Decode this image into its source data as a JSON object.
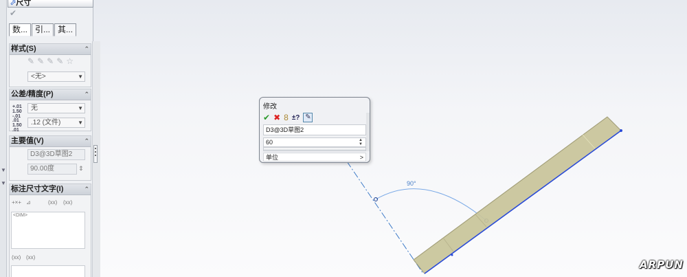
{
  "property_manager": {
    "title": "尺寸",
    "tabs": [
      "数...",
      "引...",
      "其..."
    ],
    "style_group": {
      "header": "样式(S)",
      "style_dropdown": "<无>"
    },
    "tolerance_group": {
      "header": "公差/精度(P)",
      "tolerance_type": "无",
      "precision": ".12 (文件)"
    },
    "primary_value_group": {
      "header": "主要值(V)",
      "dimension_name": "D3@3D草图2",
      "value": "90.00度"
    },
    "dimension_text_group": {
      "header": "标注尺寸文字(I)",
      "text_box_1": "<DIM>",
      "paren_1": "(xx)",
      "paren_2": "(xx)",
      "paren_3": "(xx)",
      "paren_4": "(xx)"
    }
  },
  "modify_dialog": {
    "title": "修改",
    "toolbar": [
      "✔",
      "✖",
      "8",
      "±?",
      "✎"
    ],
    "dimension_name": "D3@3D草图2",
    "value": "60",
    "units_label": "单位",
    "units_caret": ">"
  },
  "graphics": {
    "angle_dimension_label": "90°",
    "colors": {
      "part_fill": "#c9c59a",
      "edge_blue": "#2a4bd8",
      "centerline": "#3b79c7",
      "arc": "#7aa9e6"
    }
  },
  "watermark": "ARPUN"
}
